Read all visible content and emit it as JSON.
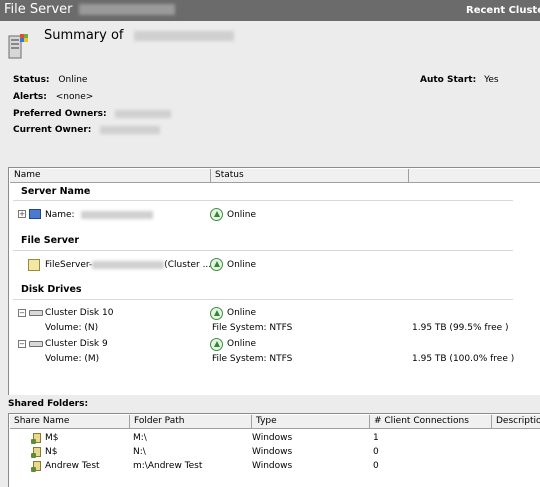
{
  "titlebar": {
    "title": "File Server",
    "recent": "Recent Cluste"
  },
  "summary": {
    "title": "Summary of",
    "status_label": "Status:",
    "status_value": "Online",
    "alerts_label": "Alerts:",
    "alerts_value": "<none>",
    "preferred_owners_label": "Preferred Owners:",
    "current_owner_label": "Current Owner:",
    "auto_start_label": "Auto Start:",
    "auto_start_value": "Yes"
  },
  "resources": {
    "columns": [
      "Name",
      "Status"
    ],
    "groups": {
      "server_name": {
        "title": "Server Name",
        "name_label": "Name:",
        "status": "Online"
      },
      "file_server": {
        "title": "File Server",
        "name_prefix": "FileServer-",
        "name_suffix": "(Cluster ...",
        "status": "Online"
      },
      "disk_drives": {
        "title": "Disk Drives",
        "disks": [
          {
            "name": "Cluster Disk 10",
            "status": "Online",
            "volume": "Volume: (N)",
            "filesystem": "File System: NTFS",
            "capacity": "1.95 TB (99.5% free )"
          },
          {
            "name": "Cluster Disk 9",
            "status": "Online",
            "volume": "Volume: (M)",
            "filesystem": "File System: NTFS",
            "capacity": "1.95 TB (100.0% free )"
          }
        ]
      }
    }
  },
  "shared_folders": {
    "label": "Shared Folders:",
    "columns": [
      "Share Name",
      "Folder Path",
      "Type",
      "# Client Connections",
      "Description"
    ],
    "rows": [
      {
        "name": "M$",
        "path": "M:\\",
        "type": "Windows",
        "connections": "1"
      },
      {
        "name": "N$",
        "path": "N:\\",
        "type": "Windows",
        "connections": "0"
      },
      {
        "name": "Andrew Test",
        "path": "m:\\Andrew Test",
        "type": "Windows",
        "connections": "0"
      }
    ]
  },
  "icons": {
    "server": "server-icon",
    "status_online": "online-arrow-icon",
    "disk": "disk-icon",
    "file_server": "file-server-icon",
    "network_name": "network-name-icon",
    "share": "share-folder-icon"
  }
}
